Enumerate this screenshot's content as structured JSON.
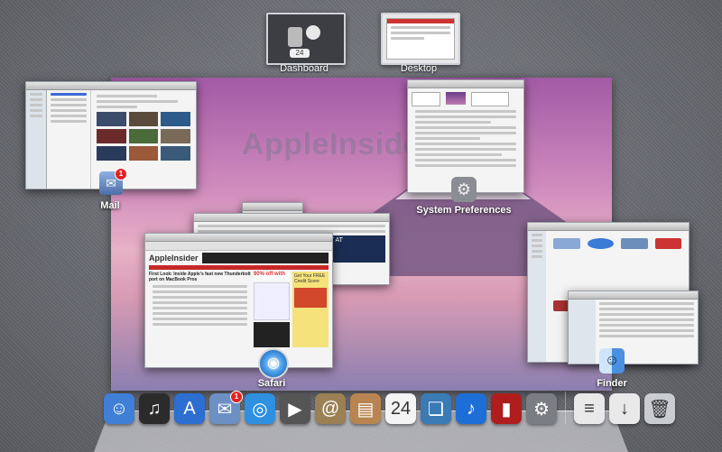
{
  "spaces": {
    "dashboard_label": "Dashboard",
    "desktop_label": "Desktop",
    "dashboard_widget_text": "24"
  },
  "wallpaper": {
    "watermark": "AppleInsider"
  },
  "apps": {
    "mail": {
      "label": "Mail",
      "badge": "1"
    },
    "system_preferences": {
      "label": "System Preferences"
    },
    "safari": {
      "label": "Safari"
    },
    "finder": {
      "label": "Finder"
    }
  },
  "safari_content": {
    "site_name": "AppleInsider",
    "headline": "First Look: Inside Apple's fast new Thunderbolt port on MacBook Pros",
    "ad_headline": "FIND OUT AT",
    "ad_percent": "90% off with",
    "ad_side": "Get Your FREE Credit Score"
  },
  "dock": {
    "items": [
      {
        "name": "finder",
        "icon": "finder-icon",
        "color": "#3f7fd6",
        "glyph": "☺"
      },
      {
        "name": "dashboard",
        "icon": "dashboard-icon",
        "color": "#2b2b2b",
        "glyph": "♫"
      },
      {
        "name": "app-store",
        "icon": "app-store-icon",
        "color": "#2c6fd1",
        "glyph": "A"
      },
      {
        "name": "mail",
        "icon": "mail-icon",
        "color": "#6c8fc4",
        "glyph": "✉",
        "badge": "1"
      },
      {
        "name": "safari",
        "icon": "safari-icon",
        "color": "#2f8fe0",
        "glyph": "◎"
      },
      {
        "name": "facetime",
        "icon": "facetime-icon",
        "color": "#555",
        "glyph": "▶"
      },
      {
        "name": "address-book",
        "icon": "address-book-icon",
        "color": "#9b8055",
        "glyph": "@"
      },
      {
        "name": "ibooks",
        "icon": "notebook-icon",
        "color": "#b8844f",
        "glyph": "▤"
      },
      {
        "name": "ical",
        "icon": "calendar-icon",
        "color": "#f4f4f4",
        "glyph": "24"
      },
      {
        "name": "preview",
        "icon": "preview-icon",
        "color": "#3a7ab5",
        "glyph": "❏"
      },
      {
        "name": "itunes",
        "icon": "itunes-icon",
        "color": "#1e6ed8",
        "glyph": "♪"
      },
      {
        "name": "photo-booth",
        "icon": "photo-booth-icon",
        "color": "#b01d1d",
        "glyph": "▮"
      },
      {
        "name": "system-preferences",
        "icon": "gear-icon",
        "color": "#7a7d83",
        "glyph": "⚙"
      },
      {
        "name": "documents",
        "icon": "document-icon",
        "color": "#e9e9e9",
        "glyph": "≡"
      },
      {
        "name": "downloads",
        "icon": "document-icon",
        "color": "#e9e9e9",
        "glyph": "↓"
      },
      {
        "name": "trash",
        "icon": "trash-icon",
        "color": "#c9ccd1",
        "glyph": "🗑"
      }
    ]
  }
}
